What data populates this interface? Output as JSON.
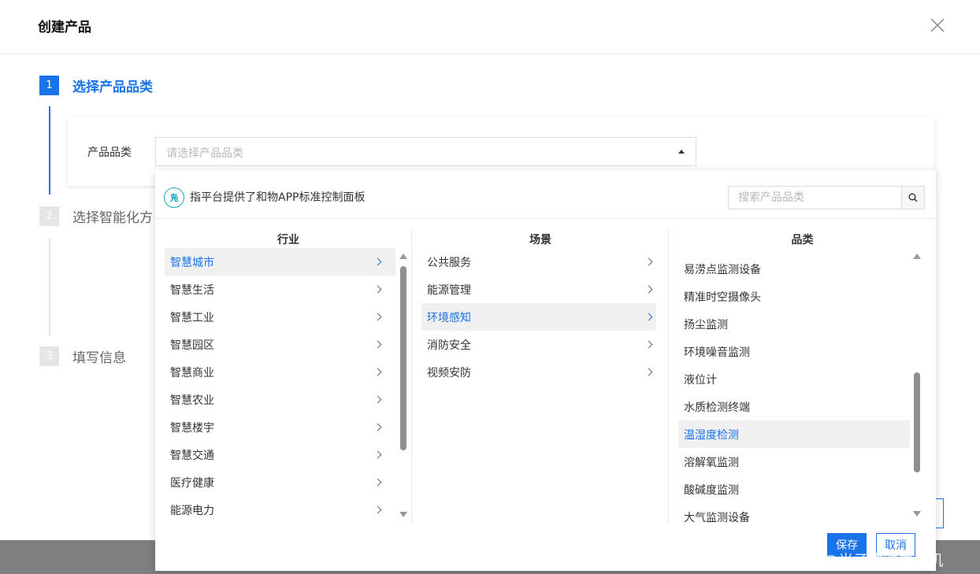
{
  "modal": {
    "title": "创建产品"
  },
  "steps": [
    {
      "num": "1",
      "label": "选择产品品类"
    },
    {
      "num": "2",
      "label": "选择智能化方"
    },
    {
      "num": "3",
      "label": "填写信息"
    }
  ],
  "form": {
    "label": "产品品类",
    "placeholder": "请选择产品品类"
  },
  "dropdown": {
    "badge": "凫",
    "tip": "指平台提供了和物APP标准控制面板",
    "search_placeholder": "搜索产品品类",
    "columns": {
      "industry": {
        "title": "行业",
        "items": [
          "智慧城市",
          "智慧生活",
          "智慧工业",
          "智慧园区",
          "智慧商业",
          "智慧农业",
          "智慧楼宇",
          "智慧交通",
          "医疗健康",
          "能源电力"
        ],
        "selected_index": 0
      },
      "scene": {
        "title": "场景",
        "items": [
          "公共服务",
          "能源管理",
          "环境感知",
          "消防安全",
          "视频安防"
        ],
        "selected_index": 2
      },
      "category": {
        "title": "品类",
        "items": [
          "易涝点监测设备",
          "精准时空摄像头",
          "扬尘监测",
          "环境噪音监测",
          "液位计",
          "水质检测终端",
          "温湿度检测",
          "溶解氧监测",
          "酸碱度监测",
          "大气监测设备"
        ],
        "selected_index": 6
      }
    },
    "save_label": "保存",
    "cancel_label": "取消"
  },
  "watermark": "CSDN @光子物联单片机",
  "colors": {
    "accent": "#1a73e8",
    "badge": "#1aa8b8"
  }
}
